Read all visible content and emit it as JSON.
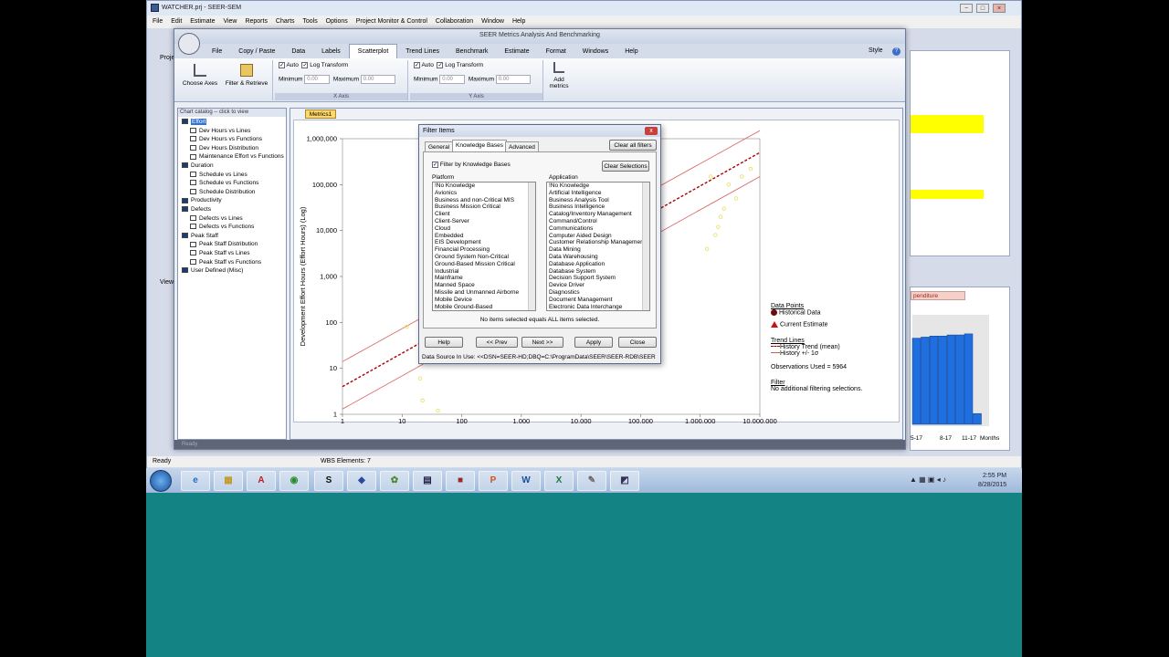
{
  "main_window": {
    "title": "WATCHER.prj - SEER-SEM",
    "menu": [
      "File",
      "Edit",
      "Estimate",
      "View",
      "Reports",
      "Charts",
      "Tools",
      "Options",
      "Project Monitor & Control",
      "Collaboration",
      "Window",
      "Help"
    ],
    "panel_left_label": "Proje",
    "panel_view_label": "View",
    "right_panel_tab": "penditure",
    "status": "Ready",
    "wbs": "WBS Elements: 7"
  },
  "seer_window": {
    "title": "SEER Metrics Analysis And Benchmarking",
    "tabs": [
      "File",
      "Copy / Paste",
      "Data",
      "Labels",
      "Scatterplot",
      "Trend Lines",
      "Benchmark",
      "Estimate",
      "Format",
      "Windows",
      "Help"
    ],
    "active_tab": "Scatterplot",
    "style_label": "Style",
    "ribbon": {
      "choose_axes": "Choose Axes",
      "filter_retrieve": "Filter & Retrieve",
      "x_axis": {
        "label": "X Axis",
        "auto": "Auto",
        "log": "Log Transform",
        "min_label": "Minimum",
        "min": "0.00",
        "max_label": "Maximum",
        "max": "0.00"
      },
      "y_axis": {
        "label": "Y Axis",
        "auto": "Auto",
        "log": "Log Transform",
        "min_label": "Minimum",
        "min": "0.00",
        "max_label": "Maximum",
        "max": "0.00"
      },
      "add_metrics": "Add metrics"
    },
    "catalog": {
      "header": "Chart catalog -- click to view",
      "items": [
        {
          "label": "Effort",
          "level": 0,
          "selected": true
        },
        {
          "label": "Dev Hours vs Lines",
          "level": 1
        },
        {
          "label": "Dev Hours vs Functions",
          "level": 1
        },
        {
          "label": "Dev Hours Distribution",
          "level": 1
        },
        {
          "label": "Maintenance Effort vs Functions",
          "level": 1
        },
        {
          "label": "Duration",
          "level": 0
        },
        {
          "label": "Schedule vs Lines",
          "level": 1
        },
        {
          "label": "Schedule vs Functions",
          "level": 1
        },
        {
          "label": "Schedule Distribution",
          "level": 1
        },
        {
          "label": "Productivity",
          "level": 0
        },
        {
          "label": "Defects",
          "level": 0
        },
        {
          "label": "Defects vs Lines",
          "level": 1
        },
        {
          "label": "Defects vs Functions",
          "level": 1
        },
        {
          "label": "Peak Staff",
          "level": 0
        },
        {
          "label": "Peak Staff Distribution",
          "level": 1
        },
        {
          "label": "Peak Staff vs Lines",
          "level": 1
        },
        {
          "label": "Peak Staff vs Functions",
          "level": 1
        },
        {
          "label": "User Defined (Misc)",
          "level": 0
        }
      ]
    },
    "chart_tab": "Metrics1",
    "status": "Ready"
  },
  "chart_data": {
    "type": "scatter",
    "xlabel": "Effective Size (Effective Size) (Log)",
    "ylabel": "Development Effort Hours (Effort Hours) (Log)",
    "x_scale": "log",
    "y_scale": "log",
    "xlim": [
      1,
      10000000
    ],
    "ylim": [
      1,
      1000000
    ],
    "x_ticks": [
      "1",
      "10",
      "100",
      "1,000",
      "10,000",
      "100,000",
      "1,000,000",
      "10,000,000"
    ],
    "y_ticks": [
      "1",
      "10",
      "100",
      "1,000",
      "10,000",
      "100,000",
      "1,000,000"
    ],
    "points_color": "#e6df5a",
    "points": [
      {
        "x": 12,
        "y": 80
      },
      {
        "x": 20,
        "y": 6
      },
      {
        "x": 22,
        "y": 2
      },
      {
        "x": 110,
        "y": 20
      },
      {
        "x": 40,
        "y": 1.2
      },
      {
        "x": 3000000,
        "y": 100000
      },
      {
        "x": 2500000,
        "y": 30000
      },
      {
        "x": 4000000,
        "y": 50000
      },
      {
        "x": 1800000,
        "y": 8000
      },
      {
        "x": 2000000,
        "y": 12000
      },
      {
        "x": 5000000,
        "y": 150000
      },
      {
        "x": 1500000,
        "y": 150000
      },
      {
        "x": 7000000,
        "y": 220000
      },
      {
        "x": 1300000,
        "y": 4000
      },
      {
        "x": 2200000,
        "y": 20000
      }
    ],
    "trend_mean": [
      [
        1,
        4
      ],
      [
        10000000,
        500000
      ]
    ],
    "trend_upper": [
      [
        1,
        14
      ],
      [
        10000000,
        1500000
      ]
    ],
    "trend_lower": [
      [
        1,
        1.3
      ],
      [
        10000000,
        150000
      ]
    ],
    "legend": {
      "data_points_title": "Data Points",
      "historical": "Historical Data",
      "current": "Current Estimate",
      "trend_title": "Trend Lines",
      "trend_mean": "History Trend (mean)",
      "trend_sigma": "History +/- 1σ",
      "observations": "Observations Used = 5964",
      "filter_title": "Filter",
      "filter_text": "No additional filtering selections."
    }
  },
  "filter_dialog": {
    "title": "Filter Items",
    "close": "x",
    "tabs": [
      "General",
      "Knowledge Bases",
      "Advanced"
    ],
    "active_tab": "Knowledge Bases",
    "clear_all": "Clear all filters",
    "filter_by_kb": "Filter by Knowledge Bases",
    "clear_selections": "Clear Selections",
    "platform_label": "Platform",
    "application_label": "Application",
    "platform": [
      "!No Knowledge",
      "Avionics",
      "Business and non-Critical MIS",
      "Business Mission Critical",
      "Client",
      "Client-Server",
      "Cloud",
      "Embedded",
      "EIS Development",
      "Financial Processing",
      "Ground System Non-Critical",
      "Ground-Based Mission Critical",
      "Industrial",
      "Mainframe",
      "Manned Space",
      "Missile and Unmanned Airborne",
      "Mobile Device",
      "Mobile Ground-Based"
    ],
    "application": [
      "!No Knowledge",
      "Artificial Intelligence",
      "Business Analysis Tool",
      "Business Intelligence",
      "Catalog/Inventory Management",
      "Command/Control",
      "Communications",
      "Computer Aided Design",
      "Customer Relationship Management",
      "Data Mining",
      "Data Warehousing",
      "Database Application",
      "Database System",
      "Decision Support System",
      "Device Driver",
      "Diagnostics",
      "Document Management",
      "Electronic Data Interchange"
    ],
    "note": "No items selected equals ALL items selected.",
    "buttons": {
      "help": "Help",
      "prev": "<< Prev",
      "next": "Next >>",
      "apply": "Apply",
      "close": "Close"
    },
    "data_source": "Data Source In Use: <<DSN=SEER-HD;DBQ=C:\\ProgramData\\SEER\\SEER-RDB\\SEER"
  },
  "right_chart": {
    "bar_color": "#1f6fe0",
    "values": [
      0.8,
      0.81,
      0.82,
      0.82,
      0.83,
      0.83,
      0.84,
      0.1
    ],
    "labels": [
      "5-17",
      "8-17",
      "11-17",
      "Months"
    ]
  },
  "taskbar": {
    "time": "2:55 PM",
    "date": "8/28/2015"
  }
}
